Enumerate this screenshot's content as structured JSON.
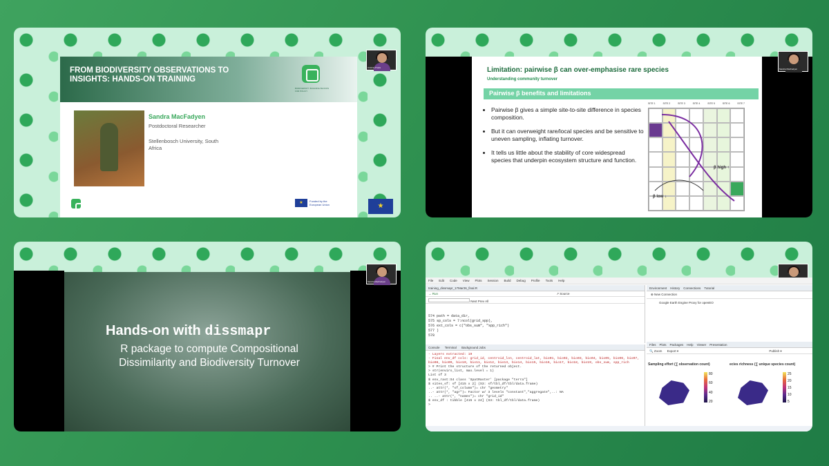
{
  "panel1": {
    "title": "FROM BIODIVERSITY OBSERVATIONS TO INSIGHTS: HANDS-ON TRAINING",
    "presenter_name": "Sandra MacFadyen",
    "presenter_role": "Postdoctoral Researcher",
    "presenter_affiliation": "Stellenbosch University, South Africa",
    "funding_text": "Funded by the European Union",
    "logo_caption": "BIODIVERSITY BUILDING BLOCKS FOR POLICY"
  },
  "panel2": {
    "title": "Limitation: pairwise β can over-emphasise rare species",
    "subtitle": "Understanding community turnover",
    "bar_title": "Pairwise β benefits and limitations",
    "bullets": [
      "Pairwise β gives a simple site-to-site difference in species composition.",
      "But it can overweight rare/local species and be sensitive to uneven sampling, inflating turnover.",
      "It tells us little about the stability of core widespread species that underpin ecosystem structure and function."
    ],
    "site_headers": [
      "SITE 1",
      "SITE 2",
      "SITE 3",
      "SITE 4",
      "SITE 5",
      "SITE 6",
      "SITE 7"
    ],
    "beta_high": "β high ↑",
    "beta_low": "β low ↓"
  },
  "panel3": {
    "headline_prefix": "Hands-on with ",
    "headline_code": "dissmapr",
    "subtitle": "R package to compute Compositional Dissimilarity and Biodiversity Turnover"
  },
  "panel4": {
    "menu_items": [
      "File",
      "Edit",
      "Code",
      "View",
      "Plots",
      "Session",
      "Build",
      "Debug",
      "Profile",
      "Tools",
      "Help"
    ],
    "editor_tab": "training_dissmapr_17Mar26_final.R",
    "code_lines": [
      "574    path      = data_dir,",
      "575    sp_cols   = 7:ncol(grid_spp),",
      "576    ext_cols  = c(\"obs_sum\", \"spp_rich\")",
      "577  )",
      "578"
    ],
    "console_lines": [
      "- Layers extracted: 19",
      "- Final env_df cols: grid_id, centroid_lon, centroid_lat, bio01, bio02, bio03, bio04, bio05, bio06, bio07, bio08, bio09, bio10, bio11, bio12, bio13, bio14, bio15, bio16, bio17, bio18, bio19, obs_sum, spp_rich",
      "> # Print the structure of the returned object.",
      "> str(enviro_list, max.level = 1)",
      "List of 3",
      " $ env_rast:S4 class 'SpatRaster' [package \"terra\"]",
      " $ sites_sf: sf [415 x 2] (S3: sf/tbl_df/tbl/data.frame)",
      "  ..- attr(*, \"sf_column\")= chr \"geometry\"",
      "  ..- attr(*, \"agr\")= Factor w/ 3 levels \"constant\",\"aggregate\",..: NA",
      "  .. ..- attr(*, \"names\")= chr \"grid_id\"",
      " $ env_df  : tibble [415 x 24] (S3: tbl_df/tbl/data.frame)",
      ">"
    ],
    "env_tabs": [
      "Environment",
      "History",
      "Connections",
      "Tutorial"
    ],
    "connection": "Google Earth Engine Proxy for openEO",
    "plot_tabs": [
      "Files",
      "Plots",
      "Packages",
      "Help",
      "Viewer",
      "Presentation"
    ],
    "plot1_title": "Sampling effort (∑ observation count)",
    "plot2_title": "ecies richness (∑ unique species count)",
    "plot1_ticks": [
      "80",
      "60",
      "40",
      "20"
    ],
    "plot2_ticks": [
      "25",
      "20",
      "15",
      "10",
      "5"
    ],
    "console_tab": "Console",
    "terminal_tab": "Terminal",
    "bg_jobs_tab": "Background Jobs"
  },
  "thumbs": {
    "p1": "Cristina Prada",
    "p2": "Sandra MacFadyen",
    "p3": "Sandra MacFadyen",
    "p4": "Sandra MacFadyen"
  },
  "colors": {
    "accent": "#3aa85c",
    "pattern": "#c9f0da",
    "bg": "#2f9150"
  }
}
